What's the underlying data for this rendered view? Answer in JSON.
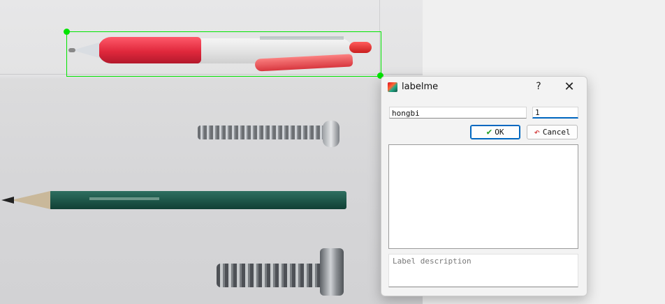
{
  "dialog": {
    "title": "labelme",
    "help_glyph": "?",
    "close_glyph": "✕",
    "label_input": {
      "value": "hongbi"
    },
    "group_id_input": {
      "value": "1"
    },
    "ok_button": {
      "label": "OK",
      "icon": "checkmark-icon"
    },
    "cancel_button": {
      "label": "Cancel",
      "icon": "undo-arrow-icon"
    },
    "description_input": {
      "placeholder": "Label description",
      "value": ""
    }
  },
  "canvas": {
    "annotation_color": "#00e400"
  },
  "colors": {
    "accent": "#0067c0",
    "ok_check": "#2aa12a",
    "cancel_arrow": "#d23232"
  }
}
